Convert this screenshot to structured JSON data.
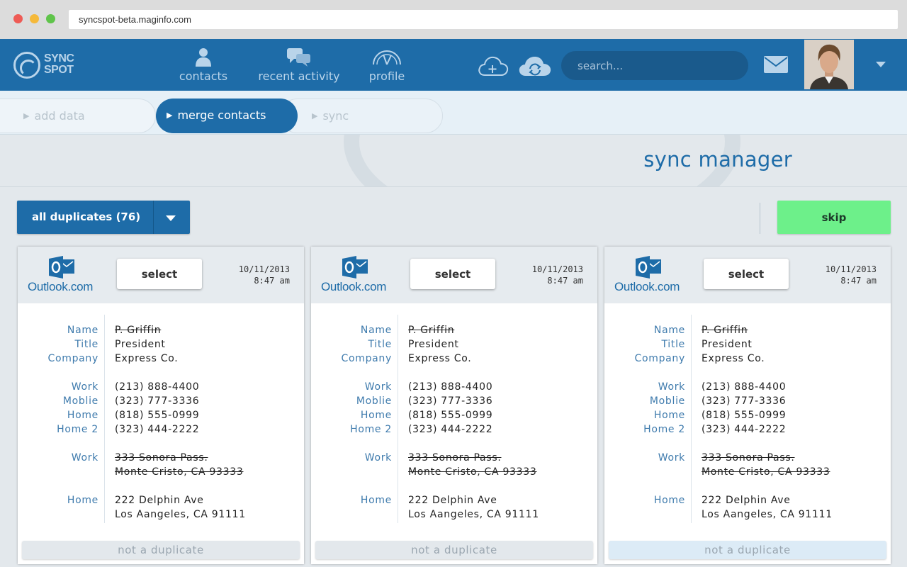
{
  "browser": {
    "url": "syncspot-beta.maginfo.com"
  },
  "header": {
    "logo_line1": "SYNC",
    "logo_line2": "SPOT",
    "nav": [
      {
        "label": "contacts",
        "icon": "person-icon"
      },
      {
        "label": "recent activity",
        "icon": "chat-bubbles-icon"
      },
      {
        "label": "profile",
        "icon": "gauge-icon"
      }
    ],
    "search_placeholder": "search..."
  },
  "steps": [
    {
      "label": "add data",
      "state": "inactive"
    },
    {
      "label": "merge contacts",
      "state": "active"
    },
    {
      "label": "sync",
      "state": "inactive"
    }
  ],
  "page_title": "sync manager",
  "toolbar": {
    "filter_label": "all duplicates (76)",
    "skip_label": "skip"
  },
  "colors": {
    "brand_blue": "#1e6ca8",
    "skip_green": "#6df08a",
    "label_blue": "#3f7bad"
  },
  "cards": [
    {
      "source": "Outlook.com",
      "select_label": "select",
      "date": "10/11/2013",
      "time": "8:47 am",
      "fields": [
        {
          "label": "Name",
          "value": "P. Griffin",
          "struck": true
        },
        {
          "label": "Title",
          "value": "President",
          "struck": false
        },
        {
          "label": "Company",
          "value": "Express Co.",
          "struck": false
        },
        {
          "label": "Work",
          "value": "(213) 888-4400",
          "struck": false
        },
        {
          "label": "Moblie",
          "value": "(323) 777-3336",
          "struck": false
        },
        {
          "label": "Home",
          "value": "(818) 555-0999",
          "struck": false
        },
        {
          "label": "Home 2",
          "value": "(323) 444-2222",
          "struck": false
        },
        {
          "label": "Work",
          "value": "333 Sonora Pass.",
          "struck": true
        },
        {
          "label": "",
          "value": "Monte Cristo, CA 93333",
          "struck": true
        },
        {
          "label": "Home",
          "value": "222 Delphin Ave",
          "struck": false
        },
        {
          "label": "",
          "value": "Los Aangeles, CA 91111",
          "struck": false
        }
      ],
      "not_dup_label": "not a duplicate"
    },
    {
      "source": "Outlook.com",
      "select_label": "select",
      "date": "10/11/2013",
      "time": "8:47 am",
      "fields": [
        {
          "label": "Name",
          "value": "P. Griffin",
          "struck": true
        },
        {
          "label": "Title",
          "value": "President",
          "struck": false
        },
        {
          "label": "Company",
          "value": "Express Co.",
          "struck": false
        },
        {
          "label": "Work",
          "value": "(213) 888-4400",
          "struck": false
        },
        {
          "label": "Moblie",
          "value": "(323) 777-3336",
          "struck": false
        },
        {
          "label": "Home",
          "value": "(818) 555-0999",
          "struck": false
        },
        {
          "label": "Home 2",
          "value": "(323) 444-2222",
          "struck": false
        },
        {
          "label": "Work",
          "value": "333 Sonora Pass.",
          "struck": true
        },
        {
          "label": "",
          "value": "Monte Cristo, CA 93333",
          "struck": true
        },
        {
          "label": "Home",
          "value": "222 Delphin Ave",
          "struck": false
        },
        {
          "label": "",
          "value": "Los Aangeles, CA 91111",
          "struck": false
        }
      ],
      "not_dup_label": "not a duplicate"
    },
    {
      "source": "Outlook.com",
      "select_label": "select",
      "date": "10/11/2013",
      "time": "8:47 am",
      "fields": [
        {
          "label": "Name",
          "value": "P. Griffin",
          "struck": true
        },
        {
          "label": "Title",
          "value": "President",
          "struck": false
        },
        {
          "label": "Company",
          "value": "Express Co.",
          "struck": false
        },
        {
          "label": "Work",
          "value": "(213) 888-4400",
          "struck": false
        },
        {
          "label": "Moblie",
          "value": "(323) 777-3336",
          "struck": false
        },
        {
          "label": "Home",
          "value": "(818) 555-0999",
          "struck": false
        },
        {
          "label": "Home 2",
          "value": "(323) 444-2222",
          "struck": false
        },
        {
          "label": "Work",
          "value": "333 Sonora Pass.",
          "struck": true
        },
        {
          "label": "",
          "value": "Monte Cristo, CA 93333",
          "struck": true
        },
        {
          "label": "Home",
          "value": "222 Delphin Ave",
          "struck": false
        },
        {
          "label": "",
          "value": "Los Aangeles, CA 91111",
          "struck": false
        }
      ],
      "not_dup_label": "not a duplicate"
    }
  ]
}
